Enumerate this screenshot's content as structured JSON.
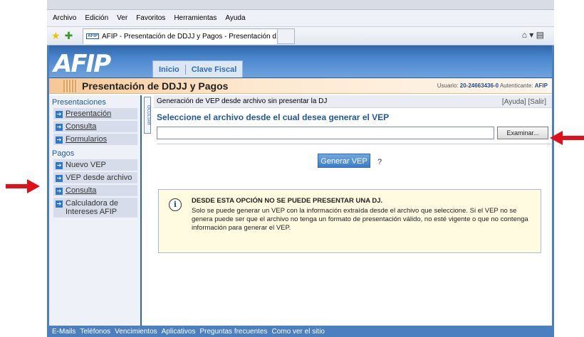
{
  "browser": {
    "menu": [
      {
        "label": "Archivo"
      },
      {
        "label": "Edición"
      },
      {
        "label": "Ver"
      },
      {
        "label": "Favoritos"
      },
      {
        "label": "Herramientas"
      },
      {
        "label": "Ayuda"
      }
    ],
    "tab_title": "AFIP - Presentación de DDJJ y Pagos - Presentación d...",
    "tab_favicon": "AFIP"
  },
  "header": {
    "logo": "AFIP",
    "nav": [
      "Inicio",
      "Clave Fiscal"
    ]
  },
  "titlebar": {
    "title": "Presentación de DDJJ y Pagos",
    "usuario_label": "Usuario:",
    "usuario_value": "20-24663436-0",
    "autenticante_label": "Autenticante:",
    "autenticante_value": "AFIP"
  },
  "sidebar": {
    "sections": [
      {
        "title": "Presentaciones",
        "items": [
          "Presentación",
          "Consulta",
          "Formularios"
        ]
      },
      {
        "title": "Pagos",
        "items": [
          "Nuevo VEP",
          "VEP desde archivo",
          "Consulta",
          "Calculadora de Intereses AFIP"
        ]
      }
    ],
    "ocultar": "OCULTAR"
  },
  "content": {
    "bar_title": "Generación de VEP desde archivo sin presentar la DJ",
    "ayuda": "[Ayuda]",
    "salir": "[Salir]",
    "select_title": "Seleccione el archivo desde el cual desea generar el VEP",
    "file_value": "",
    "browse_label": "Examinar...",
    "generate_label": "Generar VEP",
    "help_mark": "?",
    "info_heading": "DESDE ESTA OPCIÓN NO SE PUEDE PRESENTAR UNA DJ.",
    "info_body": "Solo se puede generar un VEP con la información extraída desde el archivo que seleccione. Si el VEP no se genera puede ser que el archivo no tenga un formato de presentación válido, no esté vigente o que no contenga información para generar el VEP."
  },
  "footer": {
    "links": [
      "E-Mails",
      "Teléfonos",
      "Vencimientos",
      "Aplicativos",
      "Preguntas frecuentes",
      "Como ver el sitio"
    ]
  },
  "colors": {
    "accent": "#2f66a8",
    "arrow": "#e0101a",
    "info_bg": "#fffbe0"
  }
}
